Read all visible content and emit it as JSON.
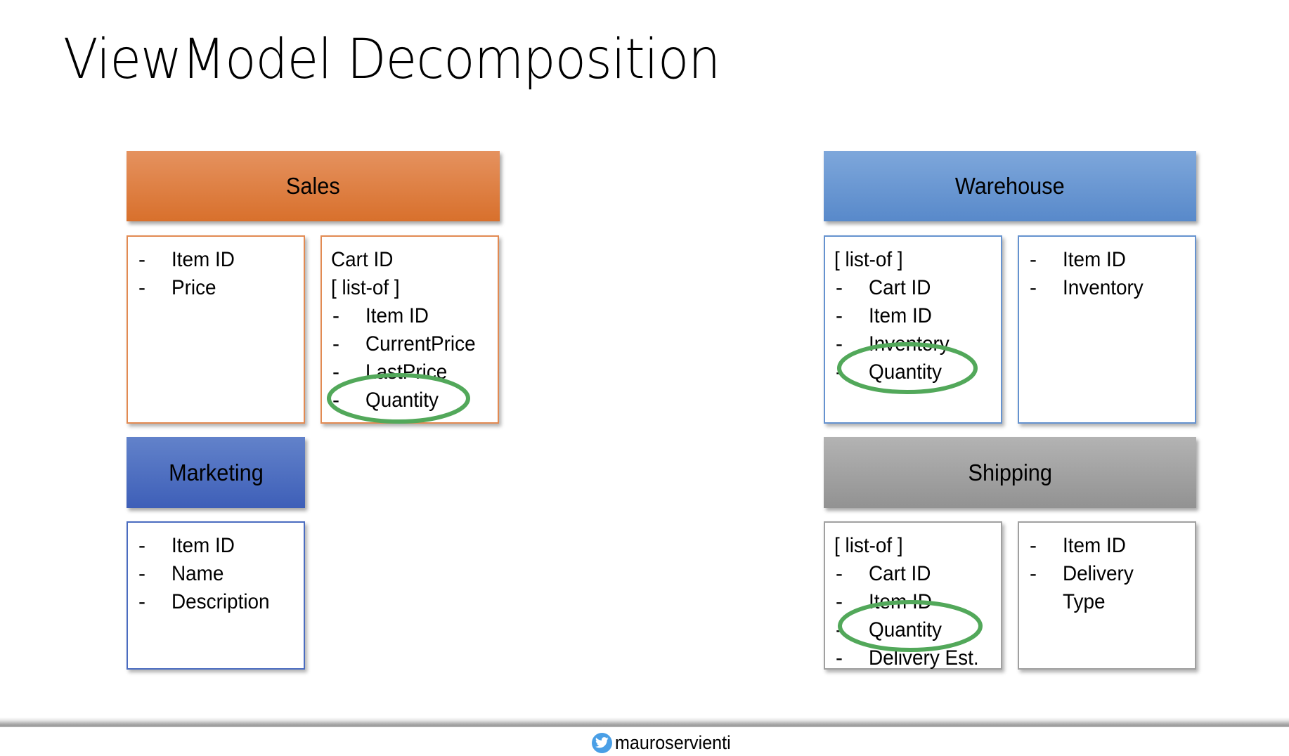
{
  "slide": {
    "title": "ViewModel Decomposition",
    "footer_handle": "mauroservienti",
    "footer_icon": "twitter-bird-icon"
  },
  "colors": {
    "sales": "#e07f43",
    "marketing": "#4c6dc0",
    "warehouse": "#6b98d3",
    "shipping": "#a3a3a3",
    "highlight_ellipse": "#52a85a"
  },
  "services": {
    "sales": {
      "label": "Sales",
      "boxes": [
        {
          "lines": [
            {
              "dash": "-",
              "text": "Item ID"
            },
            {
              "dash": "-",
              "text": "Price"
            }
          ]
        },
        {
          "lines": [
            {
              "dash": "",
              "text": "Cart ID"
            },
            {
              "dash": "",
              "text": "[ list-of ]"
            },
            {
              "dash": "-",
              "text": "Item ID"
            },
            {
              "dash": "-",
              "text": "CurrentPrice"
            },
            {
              "dash": "-",
              "text": "LastPrice"
            },
            {
              "dash": "-",
              "text": "Quantity",
              "highlighted": true
            }
          ]
        }
      ]
    },
    "marketing": {
      "label": "Marketing",
      "boxes": [
        {
          "lines": [
            {
              "dash": "-",
              "text": "Item ID"
            },
            {
              "dash": "-",
              "text": "Name"
            },
            {
              "dash": "-",
              "text": "Description"
            }
          ]
        }
      ]
    },
    "warehouse": {
      "label": "Warehouse",
      "boxes": [
        {
          "lines": [
            {
              "dash": "",
              "text": "[ list-of ]"
            },
            {
              "dash": "-",
              "text": "Cart ID"
            },
            {
              "dash": "-",
              "text": "Item ID"
            },
            {
              "dash": "-",
              "text": "Inventory"
            },
            {
              "dash": "-",
              "text": "Quantity",
              "highlighted": true
            }
          ]
        },
        {
          "lines": [
            {
              "dash": "-",
              "text": "Item ID"
            },
            {
              "dash": "-",
              "text": "Inventory"
            }
          ]
        }
      ]
    },
    "shipping": {
      "label": "Shipping",
      "boxes": [
        {
          "lines": [
            {
              "dash": "",
              "text": "[ list-of ]"
            },
            {
              "dash": "-",
              "text": "Cart ID"
            },
            {
              "dash": "-",
              "text": "Item ID"
            },
            {
              "dash": "-",
              "text": "Quantity",
              "highlighted": true
            },
            {
              "dash": "-",
              "text": "Delivery Est."
            }
          ]
        },
        {
          "lines": [
            {
              "dash": "-",
              "text": "Item ID"
            },
            {
              "dash": "-",
              "text": "Delivery"
            },
            {
              "dash": "",
              "text": "Type",
              "continuation": true
            }
          ]
        }
      ]
    }
  }
}
